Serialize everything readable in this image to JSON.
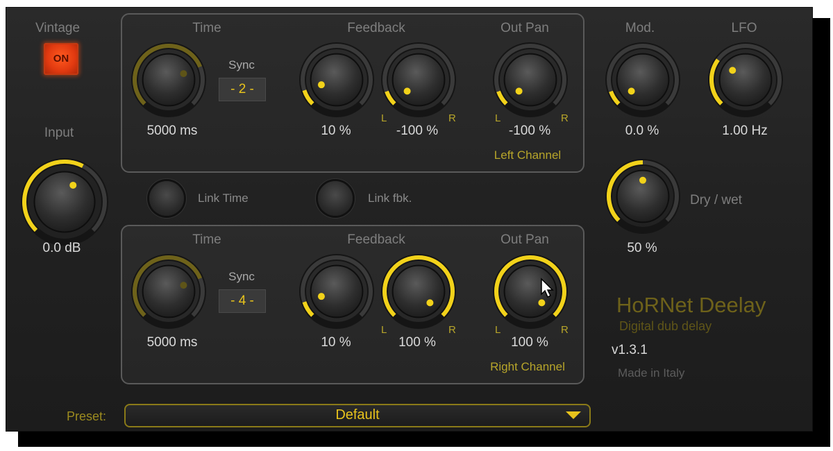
{
  "vintage": {
    "label": "Vintage",
    "button": "ON"
  },
  "input": {
    "label": "Input",
    "value": "0.0 dB",
    "level": 0.6
  },
  "left": {
    "time_label": "Time",
    "time_value": "5000 ms",
    "time_level": 0.75,
    "sync_label": "Sync",
    "sync_value": "- 2 -",
    "feedback_label": "Feedback",
    "feedback_value": "10 %",
    "feedback_level": 0.1,
    "pan_value": "-100 %",
    "pan_level": 0.0,
    "outpan_label": "Out Pan",
    "outpan_value": "-100 %",
    "outpan_level": 0.0,
    "L": "L",
    "R": "R",
    "channel": "Left Channel"
  },
  "right": {
    "time_label": "Time",
    "time_value": "5000 ms",
    "time_level": 0.75,
    "sync_label": "Sync",
    "sync_value": "- 4 -",
    "feedback_label": "Feedback",
    "feedback_value": "10 %",
    "feedback_level": 0.1,
    "pan_value": "100 %",
    "pan_level": 1.0,
    "outpan_label": "Out Pan",
    "outpan_value": "100 %",
    "outpan_level": 1.0,
    "L": "L",
    "R": "R",
    "channel": "Right Channel"
  },
  "link": {
    "time": "Link Time",
    "fbk": "Link fbk."
  },
  "mod": {
    "label": "Mod.",
    "value": "0.0 %",
    "level": 0.0
  },
  "lfo": {
    "label": "LFO",
    "value": "1.00 Hz",
    "level": 0.3
  },
  "drywet": {
    "label": "Dry / wet",
    "value": "50 %",
    "level": 0.5
  },
  "preset": {
    "label": "Preset:",
    "value": "Default"
  },
  "brand": {
    "name": "HoRNet Deelay",
    "subtitle": "Digital dub delay",
    "version": "v1.3.1",
    "made": "Made in Italy"
  },
  "colors": {
    "accent": "#f2d21a",
    "dim_accent": "#6e621a",
    "ring": "#3a3a3a"
  }
}
